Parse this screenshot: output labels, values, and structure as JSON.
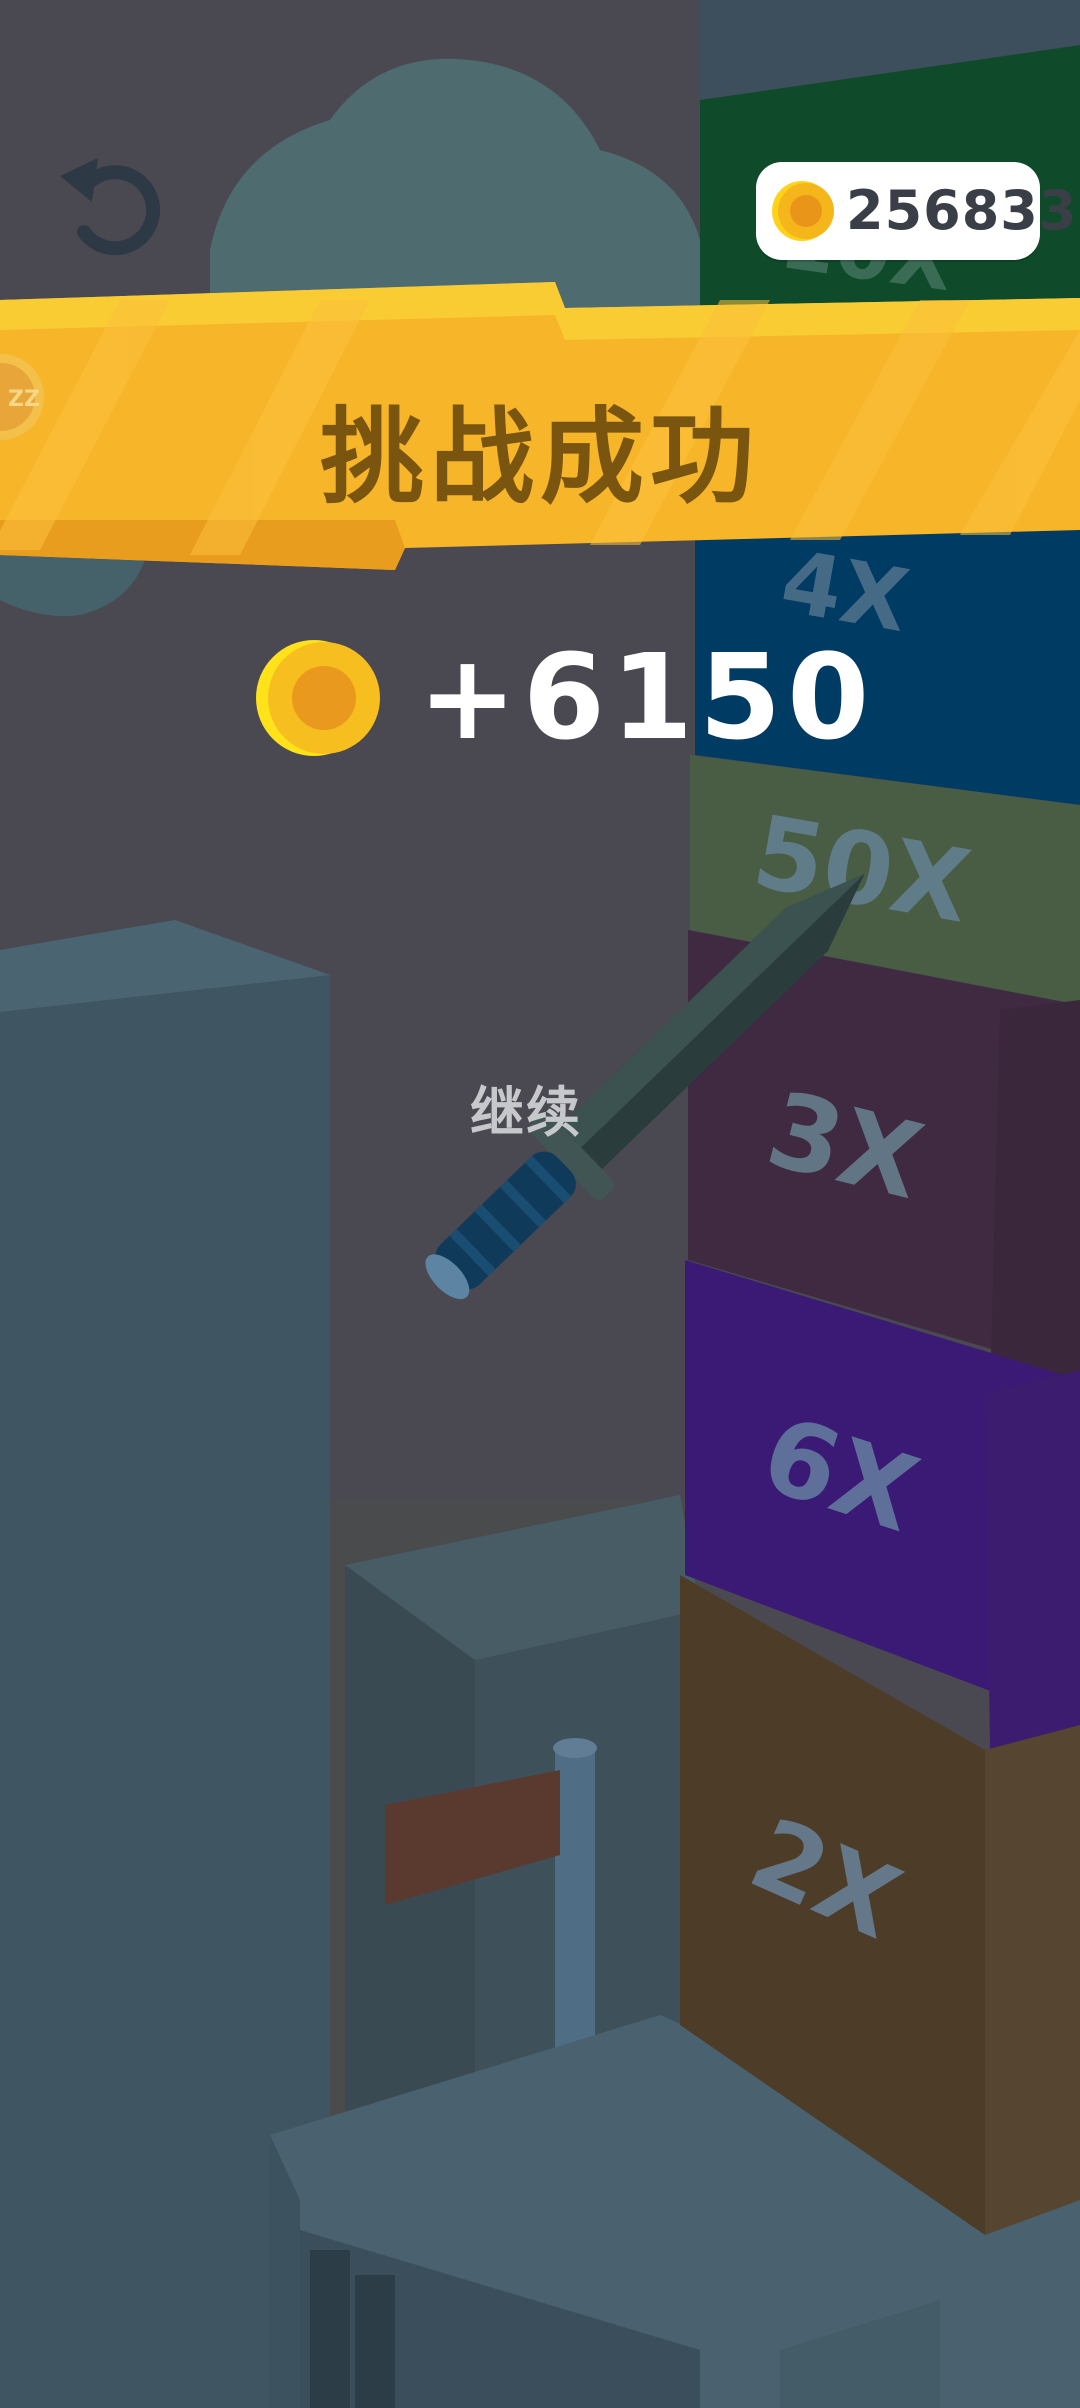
{
  "hud": {
    "coin_balance": "256833",
    "undo_icon": "undo-arrow-icon"
  },
  "banner": {
    "title": "挑战成功",
    "side_badge_text": "ZZ"
  },
  "reward": {
    "amount": "+6150",
    "coin_icon": "coin-icon"
  },
  "actions": {
    "continue_label": "继续"
  },
  "tower_blocks": [
    {
      "label": "10X"
    },
    {
      "label": "4X"
    },
    {
      "label": "50X"
    },
    {
      "label": "3X"
    },
    {
      "label": "6X"
    },
    {
      "label": "2X"
    }
  ],
  "colors": {
    "banner": "#f7b52a",
    "coin": "#f4c016",
    "reward_text": "#ffffff",
    "title_text": "#7a5510"
  }
}
